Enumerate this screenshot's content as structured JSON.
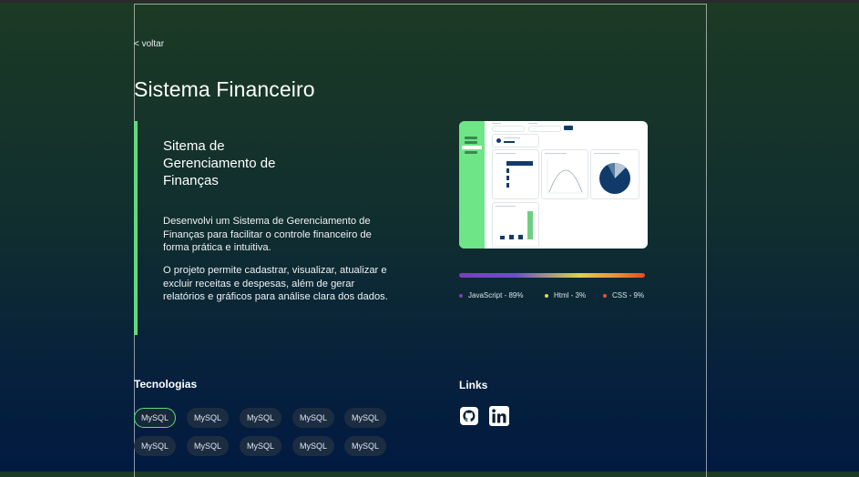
{
  "nav": {
    "back_label": "< voltar"
  },
  "project": {
    "title": "Sistema Financeiro",
    "subtitle": "Sitema de Gerenciamento de Finanças",
    "description": [
      "Desenvolvi um Sistema de Gerenciamento de Finanças para facilitar o controle financeiro de forma prática e intuitiva.",
      "O projeto permite cadastrar, visualizar, atualizar e excluir receitas e despesas, além de gerar relatórios e gráficos para análise clara dos dados."
    ]
  },
  "languages": [
    {
      "name": "JavaScript - 89%",
      "color": "#7a3fb8"
    },
    {
      "name": "Html - 3%",
      "color": "#e3d84a"
    },
    {
      "name": "CSS - 9%",
      "color": "#e8552a"
    }
  ],
  "technologies": {
    "title": "Tecnologias",
    "items": [
      "MySQL",
      "MySQL",
      "MySQL",
      "MySQL",
      "MySQL",
      "MySQL",
      "MySQL",
      "MySQL",
      "MySQL",
      "MySQL"
    ]
  },
  "links": {
    "title": "Links",
    "items": [
      {
        "icon": "github-icon"
      },
      {
        "icon": "linkedin-icon"
      }
    ]
  },
  "colors": {
    "accent": "#5edc7d",
    "chip_bg": "#1c2d42"
  }
}
